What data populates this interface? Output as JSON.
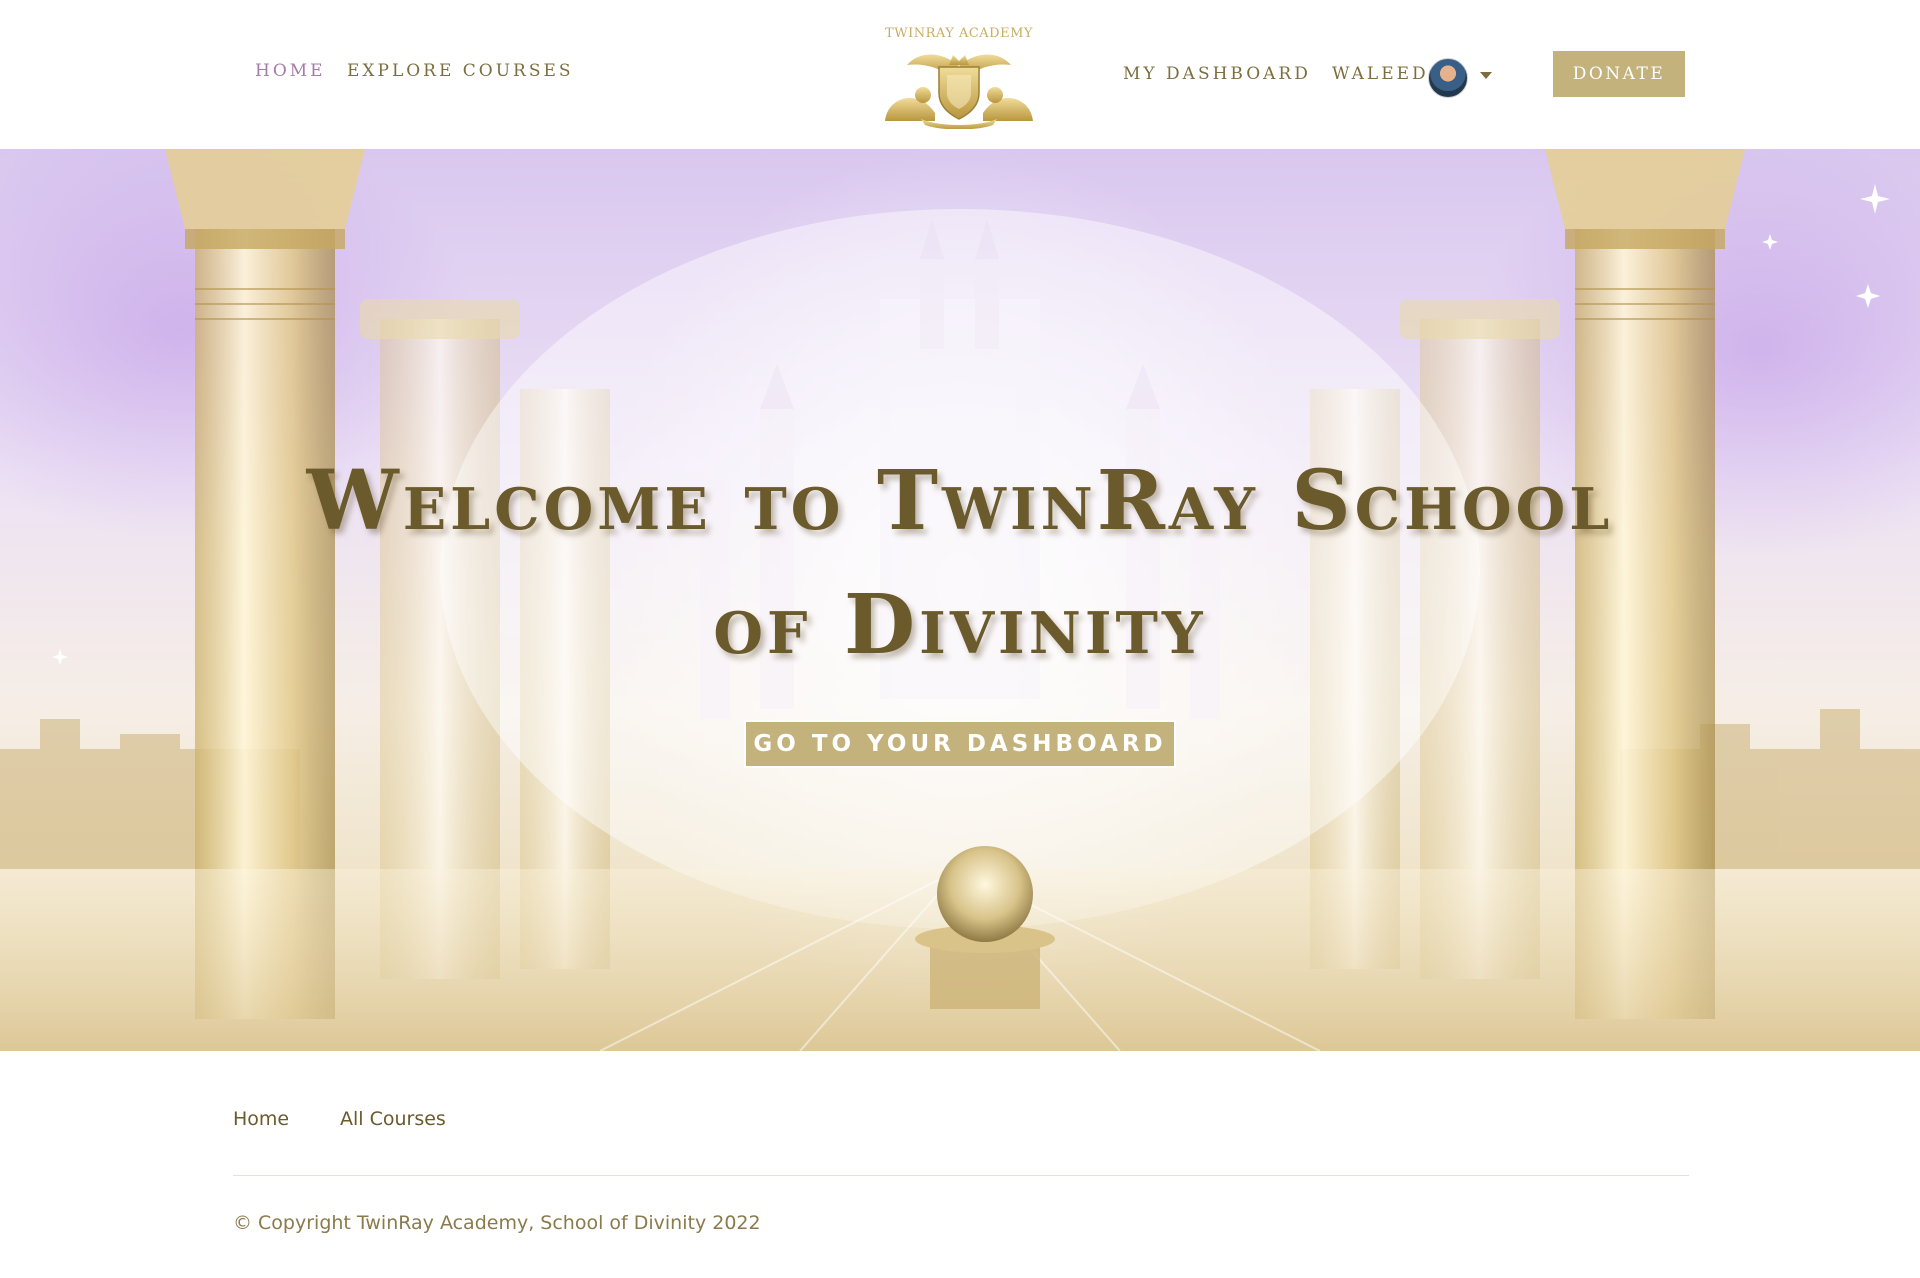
{
  "header": {
    "nav_home": "HOME",
    "nav_explore": "EXPLORE COURSES",
    "logo_text": "TWINRAY ACADEMY",
    "nav_dashboard": "MY DASHBOARD",
    "user_name": "WALEED",
    "donate_label": "DONATE"
  },
  "hero": {
    "title": "Welcome to TwinRay School of Divinity",
    "cta_label": "GO TO YOUR DASHBOARD"
  },
  "footer": {
    "links": [
      "Home",
      "All Courses"
    ],
    "copyright": "© Copyright TwinRay Academy, School of Divinity 2022"
  },
  "colors": {
    "accent_gold": "#c3b27c",
    "text_dark_gold": "#6b5a2c",
    "active_nav": "#a57ba8",
    "lavender_sky": "#d9c7ef"
  },
  "icons": {
    "logo": "crest-lions-icon",
    "avatar": "user-avatar",
    "dropdown": "caret-down-icon"
  }
}
